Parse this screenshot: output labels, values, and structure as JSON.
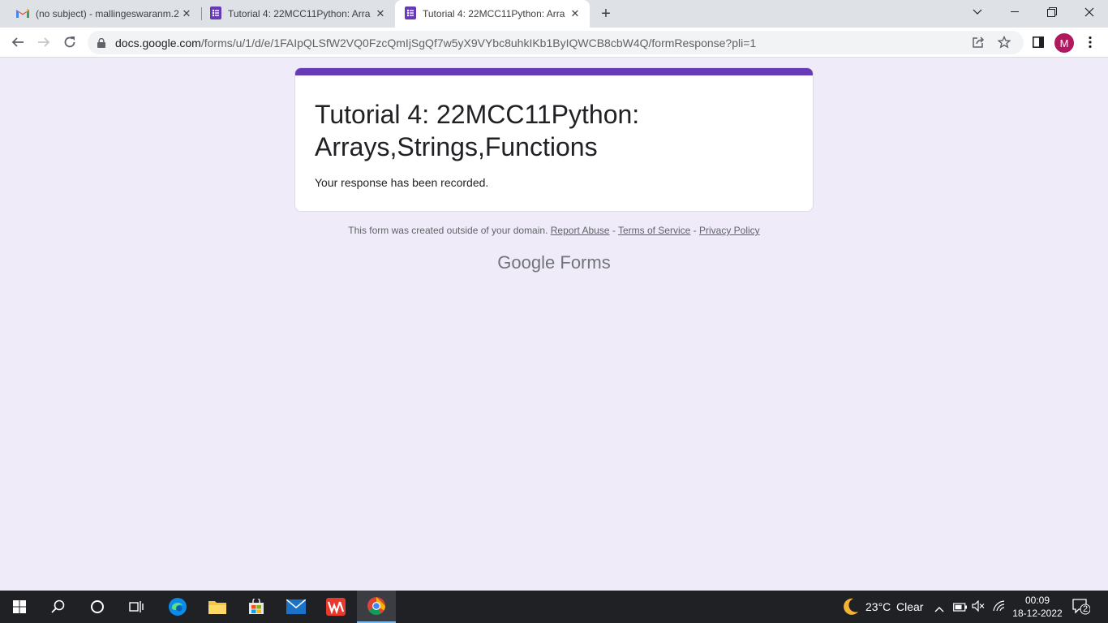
{
  "browser": {
    "tabs": [
      {
        "title": "(no subject) - mallingeswaranm.2",
        "icon": "gmail-icon"
      },
      {
        "title": "Tutorial 4: 22MCC11Python: Arra",
        "icon": "google-forms-icon"
      },
      {
        "title": "Tutorial 4: 22MCC11Python: Arra",
        "icon": "google-forms-icon",
        "active": true
      }
    ],
    "url_host": "docs.google.com",
    "url_path": "/forms/u/1/d/e/1FAIpQLSfW2VQ0FzcQmIjSgQf7w5yX9VYbc8uhkIKb1ByIQWCB8cbW4Q/formResponse?pli=1",
    "profile_initial": "M"
  },
  "form": {
    "title": "Tutorial 4: 22MCC11Python: Arrays,Strings,Functions",
    "confirmation": "Your response has been recorded.",
    "accent_color": "#673ab7"
  },
  "footer": {
    "notice": "This form was created outside of your domain.",
    "report_abuse": "Report Abuse",
    "terms": "Terms of Service",
    "privacy": "Privacy Policy",
    "separator": "-",
    "brand_google": "Google",
    "brand_forms": "Forms"
  },
  "taskbar": {
    "temperature": "23°C",
    "weather": "Clear",
    "time": "00:09",
    "date": "18-12-2022",
    "notifications": "2"
  }
}
